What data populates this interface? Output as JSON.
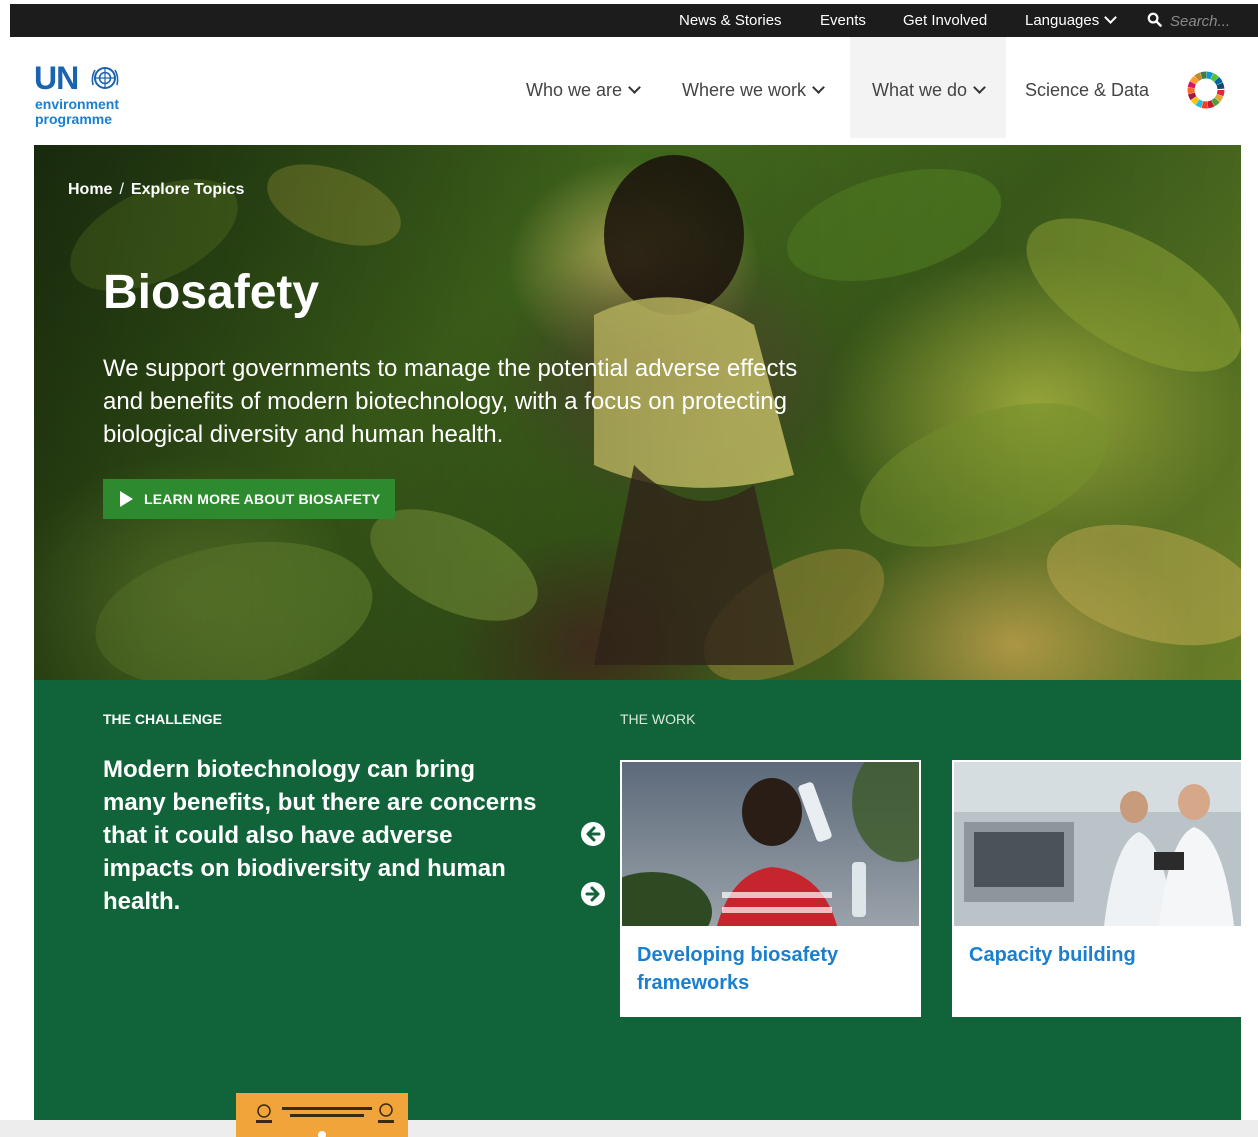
{
  "utility_nav": {
    "items": [
      "News & Stories",
      "Events",
      "Get Involved"
    ],
    "languages_label": "Languages",
    "search_placeholder": "Search..."
  },
  "logo": {
    "brand": "UN",
    "line1": "environment",
    "line2": "programme"
  },
  "main_nav": {
    "items": [
      {
        "label": "Who we are"
      },
      {
        "label": "Where we work"
      },
      {
        "label": "What we do"
      },
      {
        "label": "Science & Data"
      }
    ]
  },
  "hero": {
    "breadcrumb": [
      "Home",
      "Explore Topics"
    ],
    "breadcrumb_separator": "/",
    "title": "Biosafety",
    "description": "We support governments to manage the potential adverse effects and benefits of modern biotechnology, with a focus on protecting biological diversity and human health.",
    "cta_label": "LEARN MORE ABOUT BIOSAFETY"
  },
  "challenge": {
    "label": "THE CHALLENGE",
    "text": "Modern biotechnology can bring many benefits, but there are concerns that it could also have adverse impacts on biodiversity and human health."
  },
  "work": {
    "label": "THE WORK",
    "cards": [
      {
        "title": "Developing biosafety frameworks"
      },
      {
        "title": "Capacity building"
      }
    ]
  },
  "colors": {
    "utility_bar": "#1c1c1c",
    "un_blue": "#1a63b0",
    "cta_green": "#2d8a2e",
    "section_green": "#11643a",
    "card_link": "#1a7fd0"
  }
}
